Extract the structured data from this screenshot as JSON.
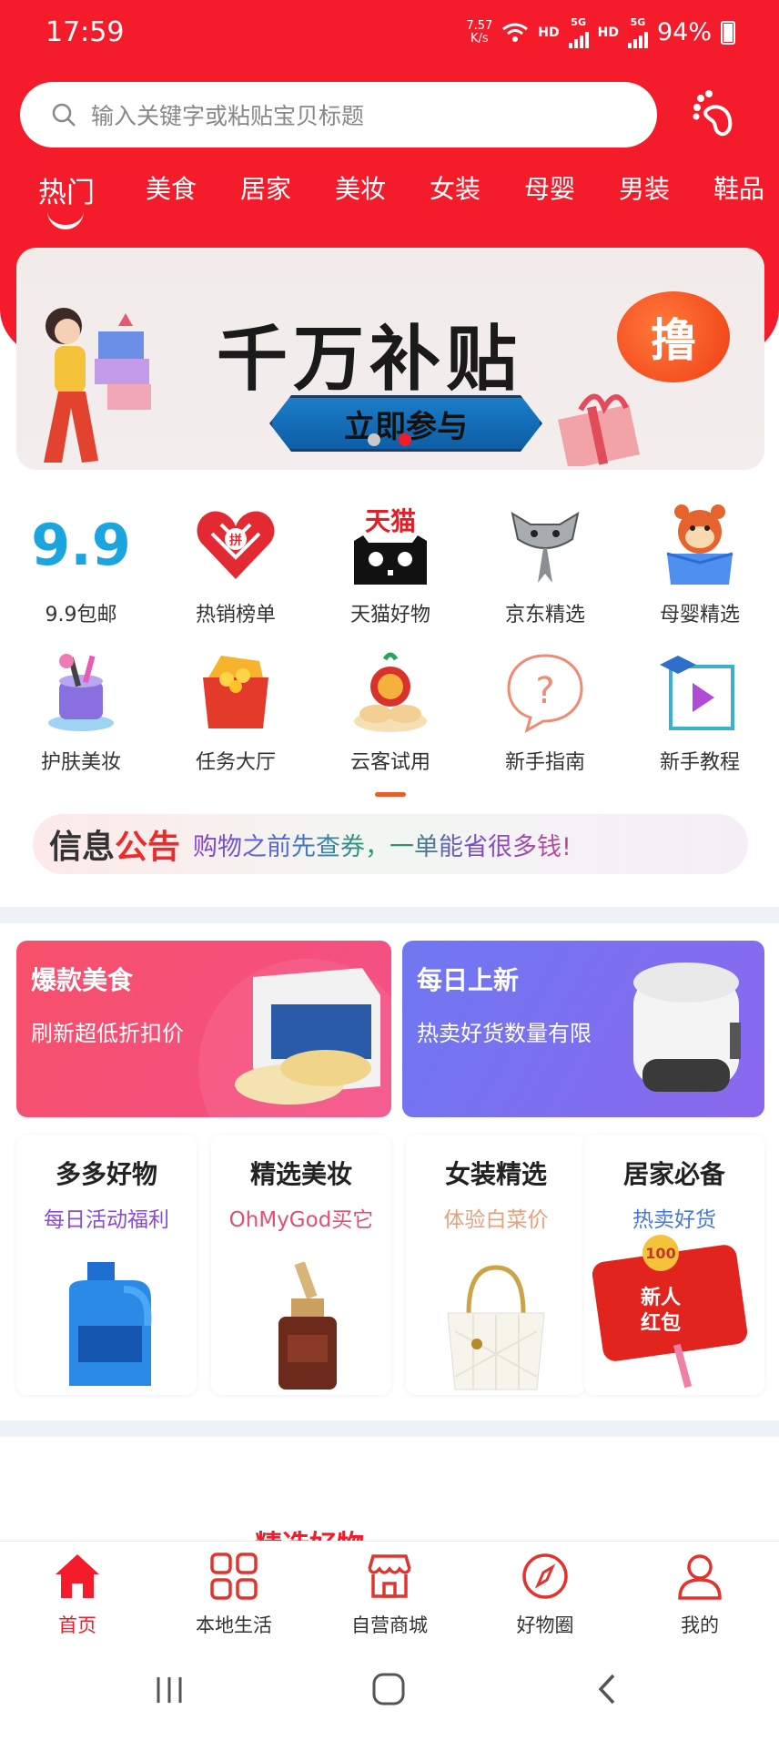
{
  "status_bar": {
    "time": "17:59",
    "net_speed": "7.57\nK/s",
    "hd1": "HD",
    "net1": "5G",
    "hd2": "HD",
    "net2": "5G",
    "battery": "94%"
  },
  "search": {
    "placeholder": "输入关键字或粘贴宝贝标题",
    "icon": "search-icon",
    "right_icon": "footprint-icon"
  },
  "categories": [
    {
      "label": "热门",
      "active": true
    },
    {
      "label": "美食"
    },
    {
      "label": "居家"
    },
    {
      "label": "美妆"
    },
    {
      "label": "女装"
    },
    {
      "label": "母婴"
    },
    {
      "label": "男装"
    },
    {
      "label": "鞋品"
    }
  ],
  "banner": {
    "title": "千万补贴",
    "badge": "撸",
    "button": "立即参与",
    "current_slide": 2,
    "total_slides": 2
  },
  "grid": [
    {
      "label": "9.9包邮",
      "icon": "nine-nine-icon",
      "icon_text": "9.9"
    },
    {
      "label": "热销榜单",
      "icon": "pinduoduo-heart-icon",
      "icon_text": "拼"
    },
    {
      "label": "天猫好物",
      "icon": "tmall-cat-icon",
      "icon_text": "天猫"
    },
    {
      "label": "京东精选",
      "icon": "jd-dog-icon"
    },
    {
      "label": "母婴精选",
      "icon": "baby-box-icon"
    },
    {
      "label": "护肤美妆",
      "icon": "cosmetics-icon"
    },
    {
      "label": "任务大厅",
      "icon": "task-box-icon"
    },
    {
      "label": "云客试用",
      "icon": "trial-cloud-icon"
    },
    {
      "label": "新手指南",
      "icon": "question-bubble-icon",
      "icon_text": "?"
    },
    {
      "label": "新手教程",
      "icon": "video-tutorial-icon"
    }
  ],
  "notice": {
    "tag_part1": "信息",
    "tag_part2": "公告",
    "message": "购物之前先查券，一单能省很多钱!"
  },
  "promos": [
    {
      "title": "爆款美食",
      "subtitle": "刷新超低折扣价"
    },
    {
      "title": "每日上新",
      "subtitle": "热卖好货数量有限"
    }
  ],
  "small_cards": [
    {
      "title": "多多好物",
      "subtitle": "每日活动福利",
      "color": "#8a4bd6"
    },
    {
      "title": "精选美妆",
      "subtitle": "OhMyGod买它",
      "color": "#e2506e"
    },
    {
      "title": "女装精选",
      "subtitle": "体验白菜价",
      "color": "#e7a07c"
    },
    {
      "title": "居家必备",
      "subtitle": "热卖好货",
      "color": "#4a78d8",
      "red_packet": "新人\n红包",
      "coin": "100"
    }
  ],
  "partial_section": "精选好物",
  "tabbar": [
    {
      "label": "首页",
      "icon": "home-icon",
      "active": true
    },
    {
      "label": "本地生活",
      "icon": "grid-icon"
    },
    {
      "label": "自营商城",
      "icon": "store-icon"
    },
    {
      "label": "好物圈",
      "icon": "compass-icon"
    },
    {
      "label": "我的",
      "icon": "user-icon"
    }
  ],
  "colors": {
    "brand_red": "#f41c2a",
    "promo_pink": "#f0455f",
    "promo_purple": "#7f6df2"
  }
}
